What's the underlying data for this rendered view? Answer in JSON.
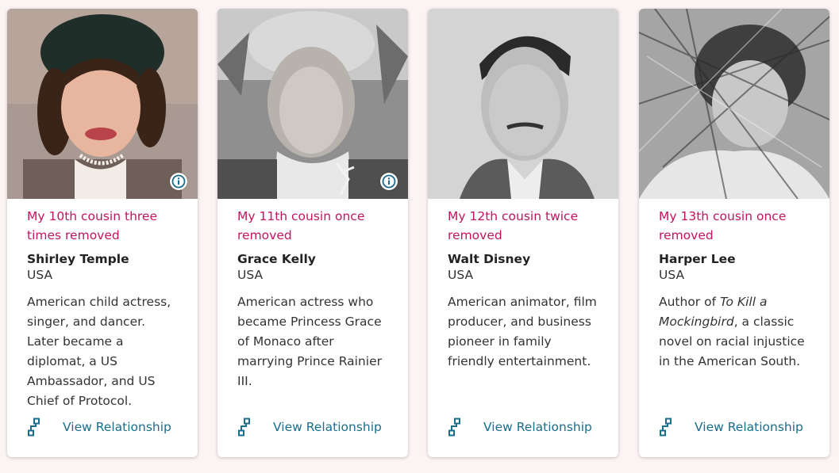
{
  "cards": [
    {
      "relation": "My 10th cousin three times removed",
      "name": "Shirley Temple",
      "country": "USA",
      "description": "American child actress, singer, and dancer. Later became a diplomat, a US Ambassador, and US Chief of Protocol.",
      "has_info_icon": true,
      "action_label": "View Relationship"
    },
    {
      "relation": "My 11th cousin once removed",
      "name": "Grace Kelly",
      "country": "USA",
      "description": "American actress who became Princess Grace of Monaco after marrying Prince Rainier III.",
      "has_info_icon": true,
      "action_label": "View Relationship"
    },
    {
      "relation": "My 12th cousin twice removed",
      "name": "Walt Disney",
      "country": "USA",
      "description": "American animator, film producer, and business pioneer in family friendly entertainment.",
      "has_info_icon": false,
      "action_label": "View Relationship"
    },
    {
      "relation": "My 13th cousin once removed",
      "name": "Harper Lee",
      "country": "USA",
      "description_pre": "Author of ",
      "description_em": "To Kill a Mockingbird",
      "description_post": ", a classic novel on racial injustice in the American South.",
      "has_info_icon": false,
      "action_label": "View Relationship"
    }
  ],
  "colors": {
    "background": "#fcf4f4",
    "relation_text": "#c21460",
    "action_text": "#1a6d8c",
    "info_icon": "#1a6d8c"
  },
  "icons": {
    "info": "info-icon",
    "relationship": "relationship-path-icon"
  }
}
